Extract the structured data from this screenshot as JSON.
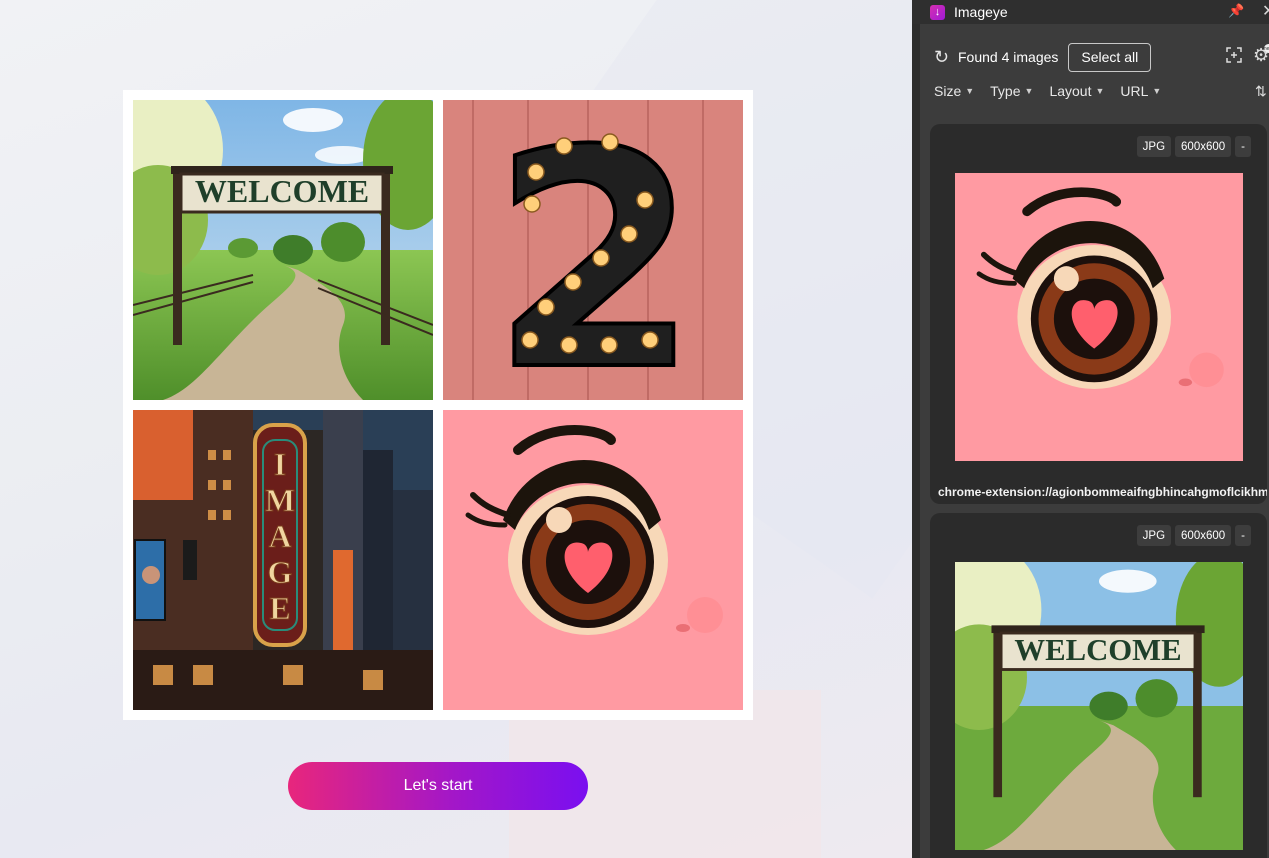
{
  "page": {
    "start_button_label": "Let's start",
    "tiles": {
      "welcome_sign_text": "WELCOME",
      "number_text": "2",
      "marquee_text": [
        "I",
        "M",
        "A",
        "G",
        "E"
      ]
    }
  },
  "extension": {
    "title": "Imageye",
    "found_label": "Found 4 images",
    "select_all_label": "Select all",
    "settings_badge": "new",
    "filters": [
      {
        "label": "Size"
      },
      {
        "label": "Type"
      },
      {
        "label": "Layout"
      },
      {
        "label": "URL"
      }
    ],
    "cards": [
      {
        "type": "JPG",
        "dimensions": "600x600",
        "extra": "-",
        "url": "chrome-extension://agionbommeaifngbhincahgmoflcikhm",
        "image": "anime-eye"
      },
      {
        "type": "JPG",
        "dimensions": "600x600",
        "extra": "-",
        "image": "welcome-sign"
      }
    ]
  },
  "colors": {
    "accent_start": "#e8267c",
    "accent_end": "#7a0ff0",
    "panel_bg": "#3c3c3c",
    "card_bg": "#2b2b2b"
  }
}
